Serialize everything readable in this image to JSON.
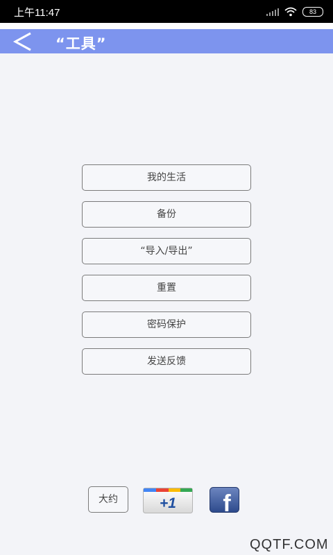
{
  "status_bar": {
    "time": "上午11:47",
    "battery": "83"
  },
  "header": {
    "title": "“工具”"
  },
  "menu": [
    {
      "label": "我的生活"
    },
    {
      "label": "备份"
    },
    {
      "label": "“导入/导出”"
    },
    {
      "label": "重置"
    },
    {
      "label": "密码保护"
    },
    {
      "label": "发送反馈"
    }
  ],
  "footer": {
    "about_label": "大约",
    "gplus_label": "+1",
    "facebook_label": "f"
  },
  "watermark": "QQTF.COM",
  "colors": {
    "header": "#7d94ee",
    "background": "#f3f4f8",
    "statusbar": "#000000"
  },
  "icons": {
    "back": "chevron-left-icon",
    "wifi": "wifi-icon",
    "signal": "signal-icon",
    "battery": "battery-icon"
  }
}
